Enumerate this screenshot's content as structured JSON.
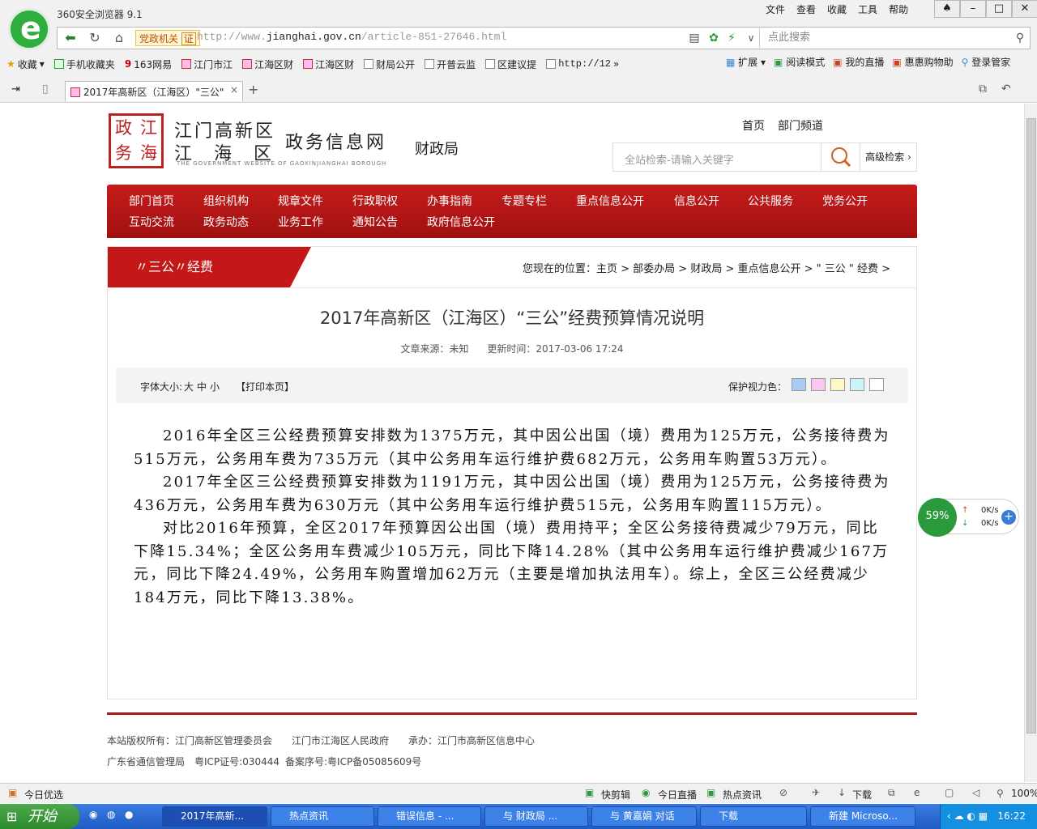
{
  "browser": {
    "app_title": "360安全浏览器 9.1",
    "menu": [
      "文件",
      "查看",
      "收藏",
      "工具",
      "帮助"
    ],
    "window_buttons": [
      "shirt-icon",
      "minimize-icon",
      "maximize-icon",
      "close-icon"
    ],
    "tag": "党政机关",
    "tag_badge": "证",
    "url_prefix": "http://www.",
    "url_domain": "jianghai.gov.cn",
    "url_path": "/article-851-27646.html",
    "search_placeholder": "点此搜索",
    "bookmarks": [
      "收藏",
      "手机收藏夹",
      "163网易",
      "江门市江",
      "江海区财",
      "江海区财",
      "财局公开",
      "开普云监",
      "区建议提",
      "http://12"
    ],
    "right_bookmarks": [
      "扩展",
      "阅读模式",
      "我的直播",
      "惠惠购物助",
      "登录管家"
    ],
    "tab_title": "2017年高新区（江海区）\"三公\""
  },
  "site": {
    "seal": [
      "政",
      "江",
      "务",
      "海"
    ],
    "name_line1": "江门高新区",
    "name_line2": "江 海 区",
    "name_right": "政务信息网",
    "name_en": "THE GOVERNMENT WEBSITE OF GAOXINJIANGHAI BOROUGH",
    "dept": "财政局",
    "top_links": [
      "首页",
      "部门频道"
    ],
    "search_placeholder": "全站检索-请输入关键字",
    "advanced_search": "高级检索",
    "nav_row1": [
      "部门首页",
      "组织机构",
      "规章文件",
      "行政职权",
      "办事指南",
      "专题专栏",
      "重点信息公开",
      "信息公开",
      "公共服务",
      "党务公开"
    ],
    "nav_row2": [
      "互动交流",
      "政务动态",
      "业务工作",
      "通知公告",
      "政府信息公开"
    ]
  },
  "article": {
    "section": "〃三公〃经费",
    "breadcrumb": "您现在的位置：主页 > 部委办局 > 财政局 > 重点信息公开 > \" 三公 \" 经费 >",
    "title": "2017年高新区（江海区）“三公”经费预算情况说明",
    "source": "文章来源：未知",
    "updated": "更新时间：2017-03-06 17:24",
    "font_size_label": "字体大小:",
    "font_sizes": [
      "大",
      "中",
      "小"
    ],
    "print": "【打印本页】",
    "eye_label": "保护视力色：",
    "eye_colors": [
      "#a8cdf4",
      "#f7c8f0",
      "#fff7c4",
      "#ccf4f8",
      "#ffffff"
    ],
    "paragraphs": [
      "2016年全区三公经费预算安排数为1375万元，其中因公出国（境）费用为125万元，公务接待费为515万元，公务用车费为735万元（其中公务用车运行维护费682万元，公务用车购置53万元）。",
      "2017年全区三公经费预算安排数为1191万元，其中因公出国（境）费用为125万元，公务接待费为436万元，公务用车费为630万元（其中公务用车运行维护费515元，公务用车购置115万元）。",
      "对比2016年预算，全区2017年预算因公出国（境）费用持平；全区公务接待费减少79万元，同比下降15.34%；全区公务用车费减少105万元，同比下降14.28%（其中公务用车运行维护费减少167万元，同比下降24.49%，公务用车购置增加62万元（主要是增加执法用车）。综上，全区三公经费减少184万元，同比下降13.38%。"
    ]
  },
  "footer": {
    "line1": [
      "本站版权所有：江门高新区管理委员会",
      "江门市江海区人民政府",
      "承办：江门市高新区信息中心"
    ],
    "line2": [
      "广东省通信管理局",
      "粤ICP证号:030444",
      "备案序号:粤ICP备05085609号"
    ]
  },
  "widget": {
    "percent": "59%",
    "up": "0K/s",
    "down": "0K/s"
  },
  "status": {
    "left": "今日优选",
    "items": [
      "快剪辑",
      "今日直播",
      "热点资讯",
      "下载"
    ],
    "zoom": "100%"
  },
  "taskbar": {
    "start": "开始",
    "tasks": [
      "2017年高新...",
      "热点资讯",
      "错误信息 - ...",
      "与 财政局 ...",
      "与 黄嘉娟 对话",
      "下载",
      "新建 Microso..."
    ],
    "time": "16:22"
  }
}
